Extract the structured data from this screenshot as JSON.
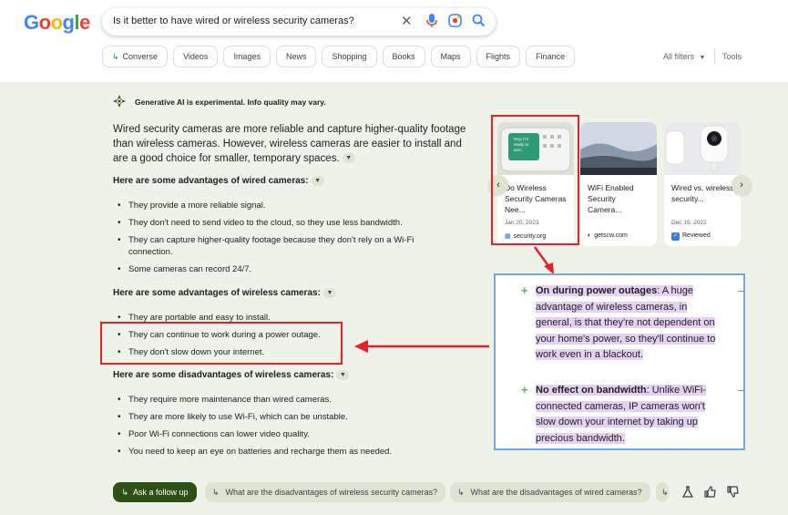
{
  "header": {
    "logo_letters": [
      "G",
      "o",
      "o",
      "g",
      "l",
      "e"
    ],
    "logo_colors": [
      "#4285f4",
      "#ea4335",
      "#fbbc05",
      "#4285f4",
      "#34a853",
      "#ea4335"
    ],
    "search_query": "Is it better to have wired or wireless security cameras?",
    "icons": [
      "close-icon",
      "mic-icon",
      "lens-icon",
      "search-icon"
    ]
  },
  "chips": [
    {
      "label": "Converse",
      "icon": "reply-arrow-icon"
    },
    {
      "label": "Videos"
    },
    {
      "label": "Images"
    },
    {
      "label": "News"
    },
    {
      "label": "Shopping"
    },
    {
      "label": "Books"
    },
    {
      "label": "Maps"
    },
    {
      "label": "Flights"
    },
    {
      "label": "Finance"
    }
  ],
  "filters": {
    "all_filters": "All filters",
    "tools": "Tools"
  },
  "overview": {
    "gen_note": "Generative AI is experimental. Info quality may vary.",
    "intro": "Wired security cameras are more reliable and capture higher-quality footage than wireless cameras. However, wireless cameras are easier to install and are a good choice for smaller, temporary spaces.",
    "sections": [
      {
        "heading": "Here are some advantages of wired cameras:",
        "items": [
          "They provide a more reliable signal.",
          "They don't need to send video to the cloud, so they use less bandwidth.",
          "They can capture higher-quality footage because they don't rely on a Wi-Fi connection.",
          "Some cameras can record 24/7."
        ]
      },
      {
        "heading": "Here are some advantages of wireless cameras:",
        "items": [
          "They are portable and easy to install.",
          "They can continue to work during a power outage.",
          "They don't slow down your internet."
        ]
      },
      {
        "heading": "Here are some disadvantages of wireless cameras:",
        "items": [
          "They require more maintenance than wired cameras.",
          "They are more likely to use Wi-Fi, which can be unstable.",
          "Poor Wi-Fi connections can lower video quality.",
          "You need to keep an eye on batteries and recharge them as needed."
        ]
      }
    ]
  },
  "cards": [
    {
      "title": "Do Wireless Security Cameras Nee...",
      "date": "Jan 20, 2023",
      "source": "security.org",
      "thumb_text": "Hey, I'm ready to arm."
    },
    {
      "title": "WiFi Enabled Security Camera...",
      "date": "",
      "source": "getscw.com"
    },
    {
      "title": "Wired vs. wireless security...",
      "date": "Dec 15, 2022",
      "source": "Reviewed"
    }
  ],
  "zoom": {
    "items": [
      {
        "bold": "On during power outages",
        "text": ": A huge advantage of wireless cameras, in general, is that they're not dependent on your home's power, so they'll continue to work even in a blackout."
      },
      {
        "bold": "No effect on bandwidth",
        "text": ": Unlike WiFi-connected cameras, IP cameras won't slow down your internet by taking up precious bandwidth."
      }
    ]
  },
  "bottom": {
    "follow_up": "Ask a follow up",
    "suggestions": [
      "What are the disadvantages of wireless security cameras?",
      "What are the disadvantages of wired cameras?"
    ],
    "icons": [
      "flask-icon",
      "thumbs-up-icon",
      "thumbs-down-icon"
    ]
  },
  "annotation_color": "#e5202a"
}
